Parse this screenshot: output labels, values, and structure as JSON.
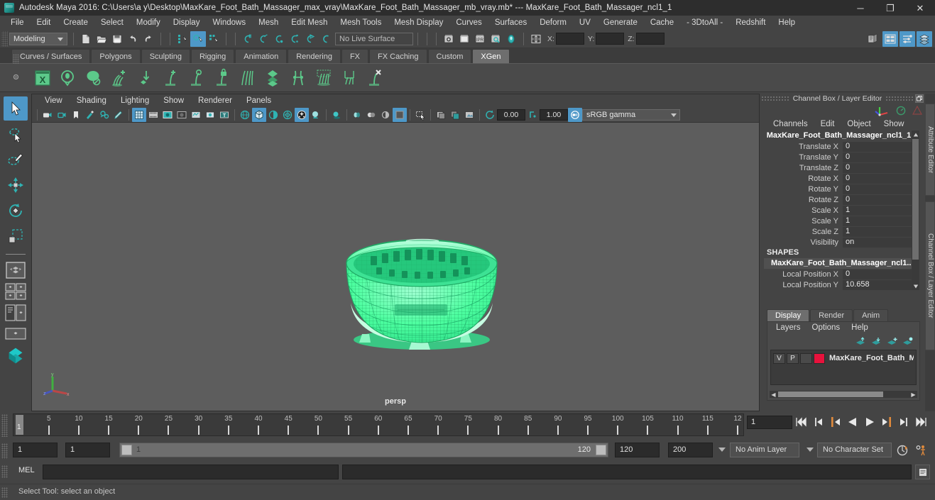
{
  "window": {
    "title": "Autodesk Maya 2016: C:\\Users\\a y\\Desktop\\MaxKare_Foot_Bath_Massager_max_vray\\MaxKare_Foot_Bath_Massager_mb_vray.mb*  ---  MaxKare_Foot_Bath_Massager_ncl1_1",
    "minimize": "─",
    "maximize": "❐",
    "close": "✕"
  },
  "menubar": {
    "items": [
      "File",
      "Edit",
      "Create",
      "Select",
      "Modify",
      "Display",
      "Windows",
      "Mesh",
      "Edit Mesh",
      "Mesh Tools",
      "Mesh Display",
      "Curves",
      "Surfaces",
      "Deform",
      "UV",
      "Generate",
      "Cache",
      "- 3DtoAll -",
      "Redshift",
      "Help"
    ]
  },
  "statusline": {
    "menuset": "Modeling",
    "live_surface": "No Live Surface",
    "coord_x_label": "X:",
    "coord_y_label": "Y:",
    "coord_z_label": "Z:",
    "coord_x_value": "",
    "coord_y_value": "",
    "coord_z_value": "",
    "icons": [
      "new-scene-icon",
      "open-scene-icon",
      "save-scene-icon",
      "undo-icon",
      "redo-icon",
      "select-by-hierarchy-icon",
      "select-by-object-icon",
      "select-by-component-icon",
      "snap-to-grid-icon",
      "snap-to-curve-icon",
      "snap-to-point-icon",
      "snap-to-projected-center-icon",
      "snap-to-view-plane-icon",
      "make-live-icon",
      "render-view-icon",
      "render-current-frame-icon",
      "ipr-render-icon",
      "render-settings-icon",
      "hypershade-icon",
      "show-hide-editors-icon",
      "toggle-attribute-editor-icon",
      "toggle-tool-settings-icon",
      "toggle-channel-box-icon"
    ]
  },
  "shelf": {
    "tabs": [
      "Curves / Surfaces",
      "Polygons",
      "Sculpting",
      "Rigging",
      "Animation",
      "Rendering",
      "FX",
      "FX Caching",
      "Custom",
      "XGen"
    ],
    "active_tab": "XGen",
    "buttons": [
      "xgen-editor-icon",
      "xgen-preview-icon",
      "xgen-create-description-icon",
      "xgen-add-grooming-icon",
      "xgen-place-guide-icon",
      "xgen-add-guide-icon",
      "xgen-sculpt-guide-icon",
      "xgen-lock-guide-icon",
      "xgen-comb-icon",
      "xgen-density-icon",
      "xgen-clump-icon",
      "xgen-noise-icon",
      "xgen-cut-icon",
      "xgen-delete-guide-icon"
    ]
  },
  "toolbox": {
    "tools": [
      {
        "name": "select-tool",
        "active": true
      },
      {
        "name": "lasso-select-tool",
        "active": false
      },
      {
        "name": "paint-selection-tool",
        "active": false
      },
      {
        "name": "move-tool",
        "active": false
      },
      {
        "name": "rotate-tool",
        "active": false
      },
      {
        "name": "scale-tool",
        "active": false
      }
    ],
    "layouts": [
      "single-perspective-layout-icon",
      "four-view-layout-icon",
      "persp-outliner-layout-icon",
      "persp-graph-layout-icon",
      "hypershade-layout-icon"
    ]
  },
  "viewport": {
    "menus": [
      "View",
      "Shading",
      "Lighting",
      "Show",
      "Renderer",
      "Panels"
    ],
    "camera_label": "persp",
    "exposure": "0.00",
    "gamma": "1.00",
    "color_management": "sRGB gamma",
    "axis": {
      "x": "x",
      "y": "y",
      "z": "z"
    },
    "toolbar_icons": [
      "select-camera-icon",
      "camera-attributes-icon",
      "bookmark-icon",
      "image-plane-icon",
      "two-d-pan-zoom-icon",
      "grease-pencil-icon",
      "grid-icon",
      "film-gate-icon",
      "resolution-gate-icon",
      "gate-mask-icon",
      "xray-joints-icon",
      "xray-icon",
      "texture-border-icon",
      "wireframe-icon",
      "smooth-shade-icon",
      "shaded-wireframe-icon",
      "textured-icon",
      "use-all-lights-icon",
      "shadows-icon",
      "screen-space-ao-icon",
      "motion-blur-icon",
      "multisample-icon",
      "depth-of-field-icon",
      "isolate-select-icon",
      "xray-active-components-icon",
      "exposure-icon",
      "gamma-icon",
      "color-management-icon"
    ]
  },
  "channelbox": {
    "panel_title": "Channel Box / Layer Editor",
    "undock_icon": "undock-icon",
    "close_icon": "close-icon",
    "menus": [
      "Channels",
      "Edit",
      "Object",
      "Show"
    ],
    "object_name": "MaxKare_Foot_Bath_Massager_ncl1_1",
    "channels": [
      {
        "label": "Translate X",
        "value": "0"
      },
      {
        "label": "Translate Y",
        "value": "0"
      },
      {
        "label": "Translate Z",
        "value": "0"
      },
      {
        "label": "Rotate X",
        "value": "0"
      },
      {
        "label": "Rotate Y",
        "value": "0"
      },
      {
        "label": "Rotate Z",
        "value": "0"
      },
      {
        "label": "Scale X",
        "value": "1"
      },
      {
        "label": "Scale Y",
        "value": "1"
      },
      {
        "label": "Scale Z",
        "value": "1"
      },
      {
        "label": "Visibility",
        "value": "on"
      }
    ],
    "shapes_header": "SHAPES",
    "shape_name": "MaxKare_Foot_Bath_Massager_ncl1...",
    "shape_channels": [
      {
        "label": "Local Position X",
        "value": "0"
      },
      {
        "label": "Local Position Y",
        "value": "10.658"
      }
    ]
  },
  "layereditor": {
    "tabs": [
      "Display",
      "Render",
      "Anim"
    ],
    "active_tab": "Display",
    "menus": [
      "Layers",
      "Options",
      "Help"
    ],
    "buttons": [
      "move-layer-up-icon",
      "move-layer-down-icon",
      "new-layer-icon",
      "new-layer-from-selected-icon"
    ],
    "layers": [
      {
        "visibility": "V",
        "playback": "P",
        "state": "",
        "color": "#e8123c",
        "name": "MaxKare_Foot_Bath_Mas"
      }
    ]
  },
  "side_tabs": [
    "Attribute Editor",
    "Channel Box / Layer Editor"
  ],
  "timeslider": {
    "start": 1,
    "end": 120,
    "current_frame": "1",
    "tick_labels": [
      "5",
      "10",
      "15",
      "20",
      "25",
      "30",
      "35",
      "40",
      "45",
      "50",
      "55",
      "60",
      "65",
      "70",
      "75",
      "80",
      "85",
      "90",
      "95",
      "100",
      "105",
      "110",
      "115",
      "12"
    ],
    "playback_buttons": [
      "go-to-start-icon",
      "step-back-keyframe-icon",
      "step-back-frame-icon",
      "play-backwards-icon",
      "play-forwards-icon",
      "step-forward-frame-icon",
      "step-forward-keyframe-icon",
      "go-to-end-icon"
    ]
  },
  "rangeslider": {
    "anim_start": "1",
    "range_start": "1",
    "bar_start_label": "1",
    "bar_end_label": "120",
    "range_end": "120",
    "anim_end": "200",
    "anim_layer": "No Anim Layer",
    "character_set": "No Character Set",
    "auto_keyframe_icon": "auto-keyframe-icon",
    "animation_prefs_icon": "animation-preferences-icon"
  },
  "commandline": {
    "language_label": "MEL",
    "input_value": "",
    "output_value": "",
    "script_editor_icon": "script-editor-icon"
  },
  "helpline": {
    "text": "Select Tool: select an object"
  },
  "colors": {
    "accent_blue": "#4e98c8",
    "teal": "#2fb3b3",
    "xgen_green": "#5cc98a",
    "selection_green": "#4dffa0",
    "layer_red": "#e8123c",
    "orange": "#e08a3c",
    "viewport_bg": "#5d5d5d",
    "panel_bg": "#444444"
  }
}
